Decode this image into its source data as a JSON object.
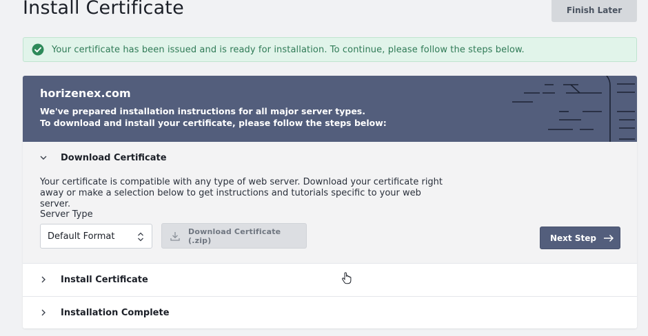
{
  "page": {
    "title": "Install Certificate",
    "finish_later_label": "Finish Later"
  },
  "alert": {
    "icon": "check-circle-icon",
    "text": "Your certificate has been issued and is ready for installation. To continue, please follow the steps below."
  },
  "card": {
    "domain": "horizenex.com",
    "intro_line_1": "We've prepared installation instructions for all major server types.",
    "intro_line_2": "To download and install your certificate, please follow the steps below:"
  },
  "steps": [
    {
      "title": "Download Certificate",
      "expanded": true,
      "description": "Your certificate is compatible with any type of web server. Download your certificate right away or make a selection below to get instructions and tutorials specific to your web server.",
      "server_type_label": "Server Type",
      "server_type_value": "Default Format",
      "download_label": "Download Certificate (.zip)",
      "next_label": "Next Step"
    },
    {
      "title": "Install Certificate",
      "expanded": false
    },
    {
      "title": "Installation Complete",
      "expanded": false
    }
  ],
  "colors": {
    "header_bg": "#535e7c",
    "alert_bg": "#e1f4ea",
    "alert_text": "#2f7a56",
    "success_icon": "#2e8a5a",
    "button_primary": "#535e7c",
    "button_disabled": "#dcdee2"
  }
}
